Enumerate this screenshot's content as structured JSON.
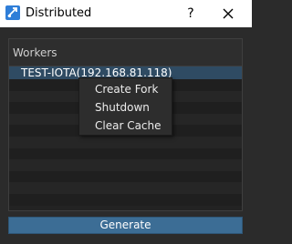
{
  "window": {
    "title": "Distributed",
    "help_label": "?",
    "app_icon": "distributed-app-icon",
    "close_icon": "close-icon"
  },
  "workers": {
    "header": "Workers",
    "items": [
      {
        "label": "TEST-IOTA(192.168.81.118)",
        "selected": true
      }
    ]
  },
  "context_menu": {
    "items": [
      "Create Fork",
      "Shutdown",
      "Clear Cache"
    ]
  },
  "actions": {
    "generate_label": "Generate"
  },
  "colors": {
    "accent": "#3c6d95",
    "selection": "#2f4b63",
    "background": "#2b2b2b"
  }
}
